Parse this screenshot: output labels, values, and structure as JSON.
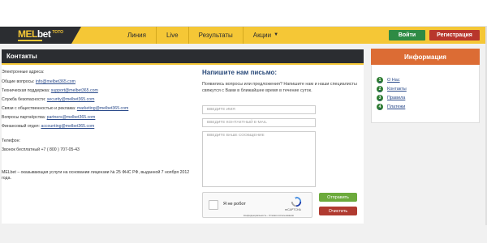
{
  "brand": {
    "logo_mel": "MEL",
    "logo_bet": "bet",
    "logo_toto": "TOTO",
    "colors": {
      "yellow": "#f5c736",
      "dark": "#2b2d31",
      "green": "#2e8b44",
      "red": "#b8362c",
      "orange": "#dc6c34"
    }
  },
  "nav": {
    "items": [
      {
        "label": "Линия"
      },
      {
        "label": "Live"
      },
      {
        "label": "Результаты"
      },
      {
        "label": "Акции"
      }
    ],
    "login_label": "Войти",
    "register_label": "Регистрация"
  },
  "contacts": {
    "title": "Контакты",
    "lines": [
      {
        "label": "Электронные адреса:",
        "link": ""
      },
      {
        "label": "Общие вопросы: ",
        "link": "info@melbet365.com"
      },
      {
        "label": "Техническая поддержка: ",
        "link": "support@melbet365.com"
      },
      {
        "label": "Служба безопасности: ",
        "link": "security@melbet365.com"
      },
      {
        "label": "Связи с общественностью и реклама: ",
        "link": "marketing@melbet365.com"
      },
      {
        "label": "Вопросы партнёрства: ",
        "link": "partners@melbet365.com"
      },
      {
        "label": "Финансовый отдел: ",
        "link": "accounting@melbet365.com"
      }
    ],
    "phone_label": "Телефон:",
    "phone_value": "Звонок бесплатный +7 ( 800 ) 707-05-43",
    "license_line1": "MELbet – оказывающая услуги на основании лицензии № 25 ФНС РФ, выданной 7 ноября 2012",
    "license_line2": "года."
  },
  "form": {
    "title": "Напишите нам письмо:",
    "description": "Появились вопросы или предложения? Напишите нам и наши специалисты свяжутся с Вами в ближайшее время в течение суток.",
    "name_placeholder": "ВВЕДИТЕ ИМЯ",
    "email_placeholder": "ВВЕДИТЕ КОНТАКТНЫЙ E-MAIL",
    "message_placeholder": "ВВЕДИТЕ ВАШЕ СООБЩЕНИЕ",
    "captcha_label": "Я не робот",
    "captcha_brand": "reCAPTCHA",
    "captcha_links": "Конфиденциальность - Условия использования",
    "send_label": "Отправить",
    "clear_label": "Очистить"
  },
  "info": {
    "title": "Информация",
    "items": [
      {
        "num": "1",
        "label": "О Нас"
      },
      {
        "num": "2",
        "label": "Контакты"
      },
      {
        "num": "3",
        "label": "Правила"
      },
      {
        "num": "4",
        "label": "Платежи"
      }
    ]
  }
}
